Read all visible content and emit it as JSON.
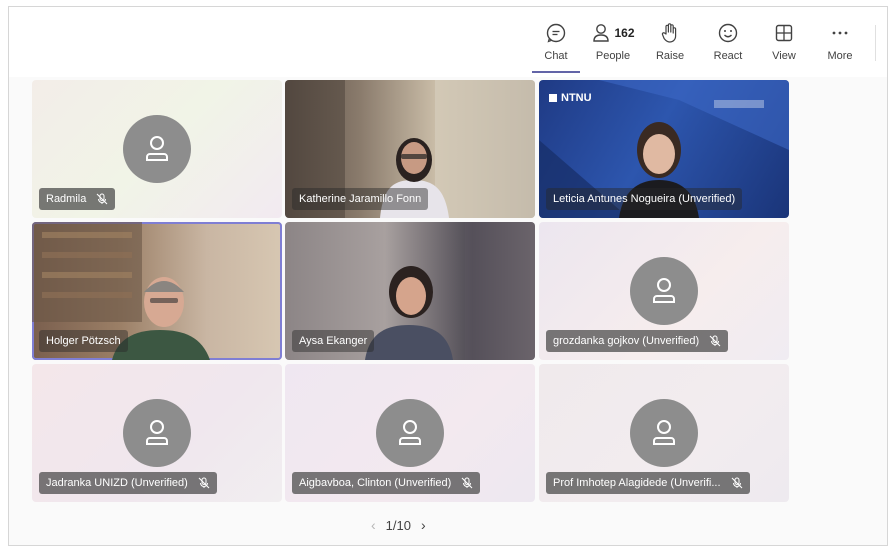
{
  "toolbar": {
    "buttons": [
      {
        "label": "Chat",
        "icon": "chat-icon"
      },
      {
        "label": "People",
        "icon": "people-icon",
        "count": "162"
      },
      {
        "label": "Raise",
        "icon": "hand-icon"
      },
      {
        "label": "React",
        "icon": "smiley-icon"
      },
      {
        "label": "View",
        "icon": "grid-icon"
      },
      {
        "label": "More",
        "icon": "more-icon"
      }
    ]
  },
  "participants": [
    {
      "name": "Radmila",
      "muted": true
    },
    {
      "name": "Katherine Jaramillo Fonn",
      "muted": false
    },
    {
      "name": "Leticia Antunes Nogueira (Unverified)",
      "muted": false
    },
    {
      "name": "Holger Pötzsch",
      "muted": false
    },
    {
      "name": "Aysa Ekanger",
      "muted": false
    },
    {
      "name": "grozdanka gojkov (Unverified)",
      "muted": true
    },
    {
      "name": "Jadranka UNIZD (Unverified)",
      "muted": true
    },
    {
      "name": "Aigbavboa, Clinton (Unverified)",
      "muted": true
    },
    {
      "name": "Prof Imhotep Alagidede (Unverifi...",
      "muted": true
    }
  ],
  "ntnu": {
    "logo_text": "NTNU"
  },
  "pager": {
    "label": "1/10"
  },
  "colors": {
    "accent": "#6264a7",
    "avatar": "#8d8d8d"
  }
}
